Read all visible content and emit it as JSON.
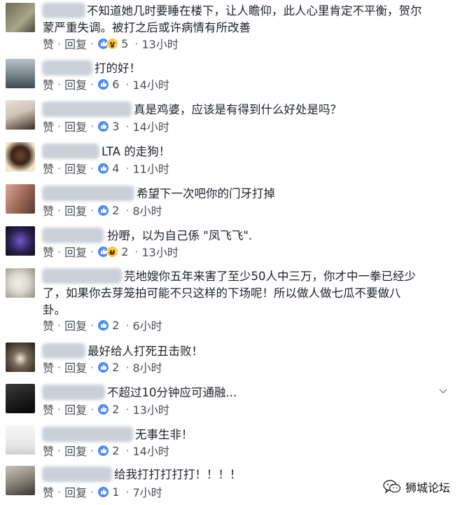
{
  "actions": {
    "like": "赞",
    "reply": "回复",
    "separator": "·"
  },
  "comments": [
    {
      "text_lines": [
        "不知道她几时要睡在楼下，让人瞻仰，此人心里肯定不平衡，贺尔",
        "蒙严重失调。被打之后或许病情有所改善"
      ],
      "reactions": [
        "like",
        "wow"
      ],
      "count": "5",
      "time": "13小时"
    },
    {
      "text_lines": [
        "打的好！"
      ],
      "reactions": [
        "like"
      ],
      "count": "6",
      "time": "14小时"
    },
    {
      "text_lines": [
        "真是鸡婆，应该是有得到什么好处是吗？"
      ],
      "reactions": [
        "like"
      ],
      "count": "3",
      "time": "14小时"
    },
    {
      "text_lines": [
        "LTA 的走狗！"
      ],
      "reactions": [
        "like"
      ],
      "count": "4",
      "time": "11小时"
    },
    {
      "text_lines": [
        "希望下一次吧你的门牙打掉"
      ],
      "reactions": [
        "like"
      ],
      "count": "2",
      "time": "8小时"
    },
    {
      "text_lines": [
        "扮嘢，以为自己係 \"凤飞飞\"."
      ],
      "reactions": [
        "like",
        "haha"
      ],
      "count": "2",
      "time": "13小时"
    },
    {
      "text_lines": [
        "芫地嫂你五年来害了至少50人中三万，你才中一拳已经少",
        "了，如果你去芽笼拍可能不只这样的下场呢！所以做人做七瓜不要做八",
        "卦。"
      ],
      "reactions": [
        "like"
      ],
      "count": "2",
      "time": "6小时"
    },
    {
      "text_lines": [
        "最好给人打死丑击败！"
      ],
      "reactions": [
        "like"
      ],
      "count": "2",
      "time": "8小时"
    },
    {
      "text_lines": [
        "不超过10分钟应可通融..."
      ],
      "reactions": [
        "like"
      ],
      "count": "2",
      "time": "13小时"
    },
    {
      "text_lines": [
        "无事生非！"
      ],
      "reactions": [
        "like"
      ],
      "count": "2",
      "time": "14小时"
    },
    {
      "text_lines": [
        "给我打打打打打！！！！"
      ],
      "reactions": [
        "like"
      ],
      "count": "1",
      "time": "7小时"
    }
  ],
  "watermark": {
    "text": "狮城论坛",
    "icon": "wechat-icon"
  },
  "colors": {
    "like_blue": "#4e8bf6",
    "meta_gray": "#4b4f56",
    "text": "#1d2129"
  }
}
